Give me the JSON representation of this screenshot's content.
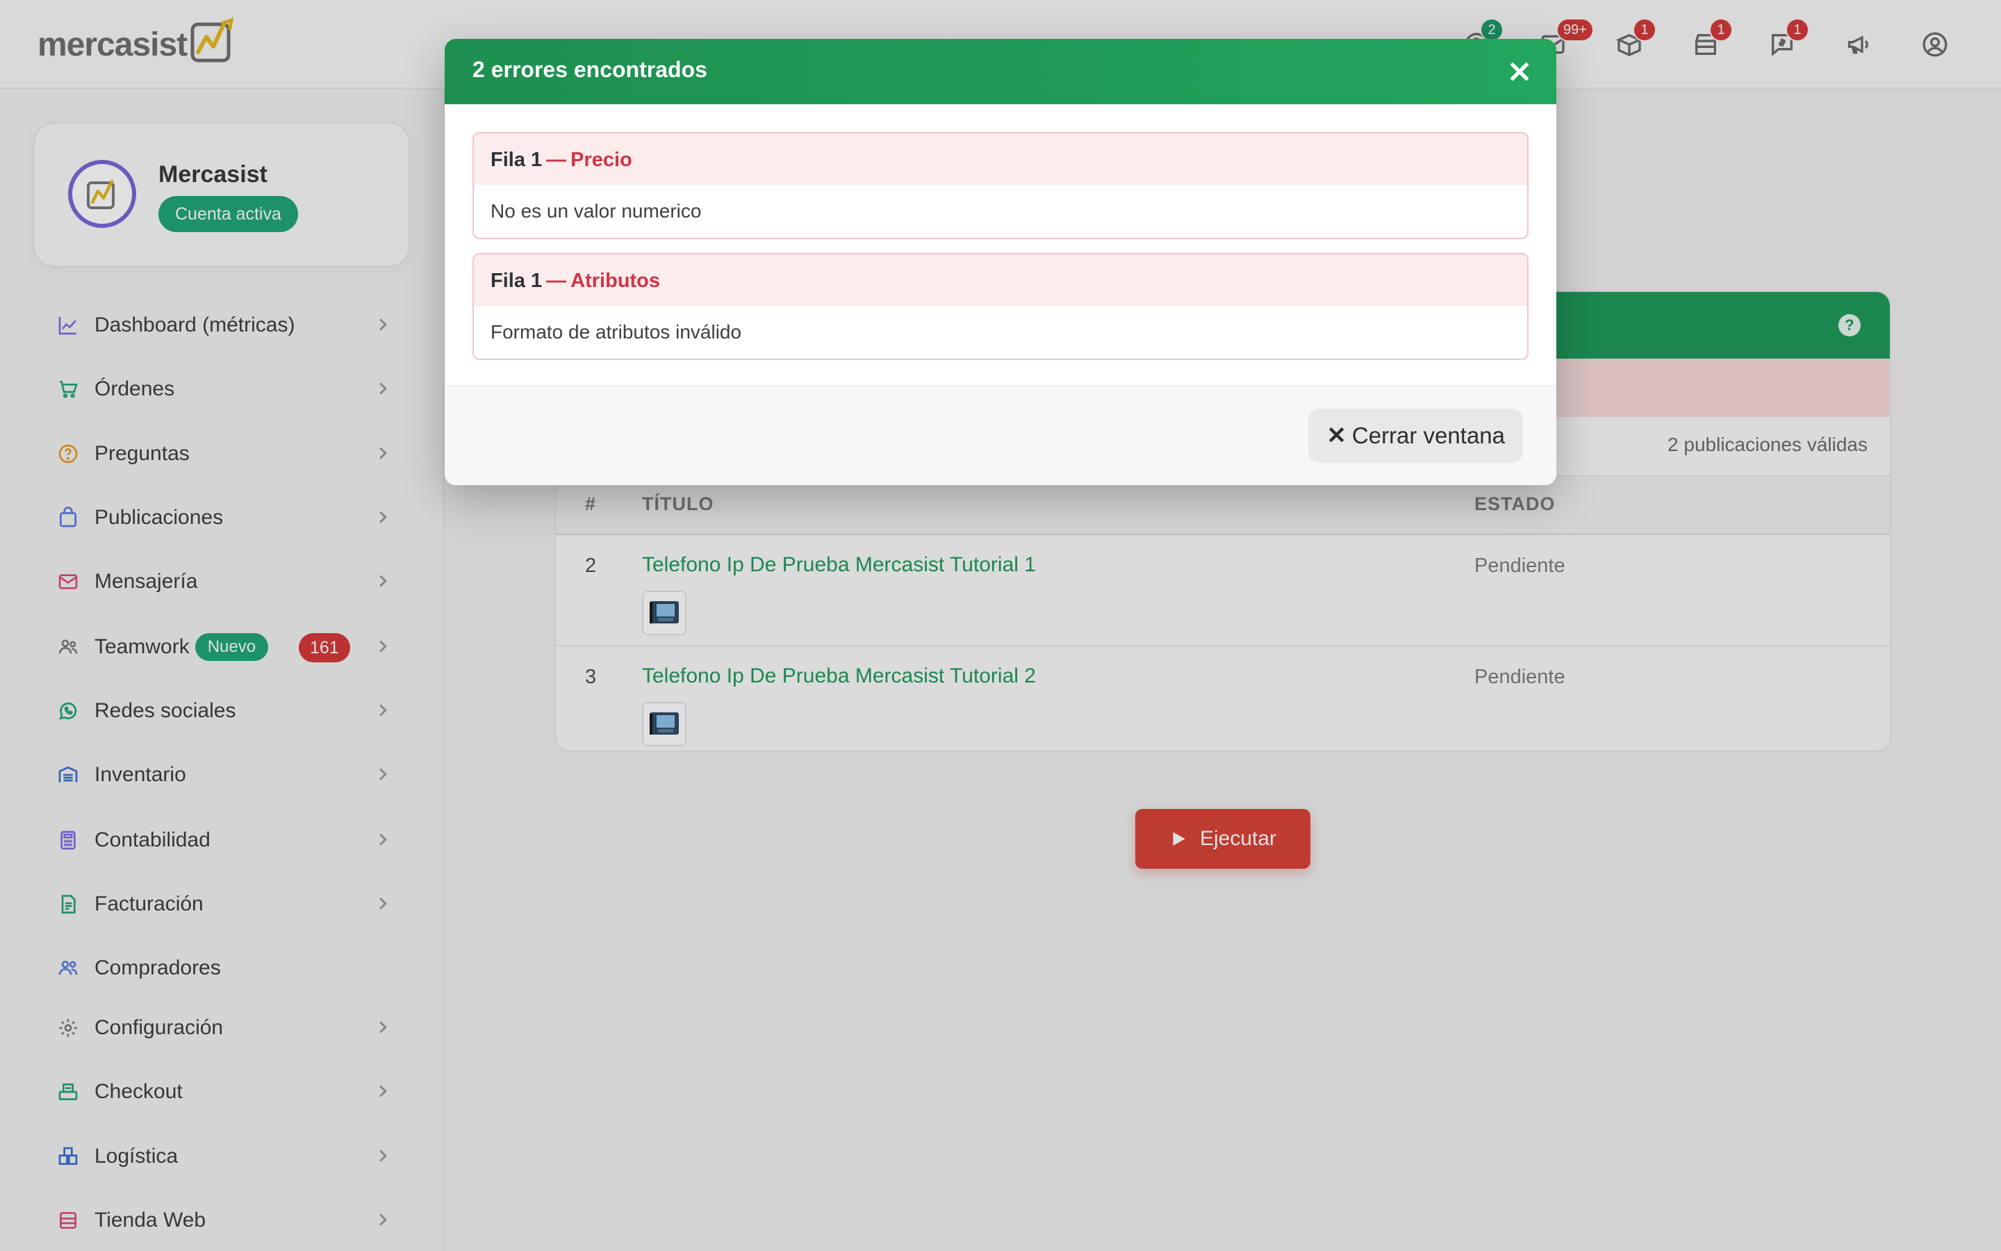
{
  "brand": {
    "logo_text": "mercasist",
    "accent_color": "#1f9a5a",
    "danger_color": "#d43a3a"
  },
  "header": {
    "icons": [
      {
        "name": "help-icon",
        "badge": "2",
        "badge_color": "green"
      },
      {
        "name": "mail-icon",
        "badge": "99+",
        "badge_color": "red"
      },
      {
        "name": "box-icon",
        "badge": "1",
        "badge_color": "red"
      },
      {
        "name": "store-icon",
        "badge": "1",
        "badge_color": "red"
      },
      {
        "name": "chat-money-icon",
        "badge": "1",
        "badge_color": "red"
      },
      {
        "name": "megaphone-icon",
        "badge": "",
        "badge_color": ""
      },
      {
        "name": "user-circle-icon",
        "badge": "",
        "badge_color": ""
      }
    ]
  },
  "sidebar": {
    "profile": {
      "name": "Mercasist",
      "status": "Cuenta activa"
    },
    "items": [
      {
        "label": "Dashboard (métricas)",
        "icon": "chart-line-icon",
        "has_chevron": true
      },
      {
        "label": "Órdenes",
        "icon": "cart-icon",
        "has_chevron": true
      },
      {
        "label": "Preguntas",
        "icon": "question-icon",
        "has_chevron": true
      },
      {
        "label": "Publicaciones",
        "icon": "bag-icon",
        "has_chevron": true
      },
      {
        "label": "Mensajería",
        "icon": "envelope-icon",
        "has_chevron": true
      },
      {
        "label": "Teamwork",
        "icon": "team-icon",
        "has_chevron": true,
        "tag": "Nuevo",
        "count": "161"
      },
      {
        "label": "Redes sociales",
        "icon": "whatsapp-icon",
        "has_chevron": true
      },
      {
        "label": "Inventario",
        "icon": "warehouse-icon",
        "has_chevron": true
      },
      {
        "label": "Contabilidad",
        "icon": "calculator-icon",
        "has_chevron": true
      },
      {
        "label": "Facturación",
        "icon": "invoice-icon",
        "has_chevron": true
      },
      {
        "label": "Compradores",
        "icon": "buyers-icon",
        "has_chevron": false
      },
      {
        "label": "Configuración",
        "icon": "gear-icon",
        "has_chevron": true
      },
      {
        "label": "Checkout",
        "icon": "checkout-icon",
        "has_chevron": true
      },
      {
        "label": "Logística",
        "icon": "truck-icon",
        "has_chevron": true
      },
      {
        "label": "Tienda Web",
        "icon": "shop-icon",
        "has_chevron": true
      }
    ]
  },
  "table": {
    "valid_count_text": "2 publicaciones válidas",
    "columns": [
      "#",
      "TÍTULO",
      "ESTADO"
    ],
    "rows": [
      {
        "num": "2",
        "title": "Telefono Ip De Prueba Mercasist Tutorial 1",
        "state": "Pendiente"
      },
      {
        "num": "3",
        "title": "Telefono Ip De Prueba Mercasist Tutorial 2",
        "state": "Pendiente"
      }
    ],
    "execute_label": "Ejecutar"
  },
  "modal": {
    "title": "2 errores encontrados",
    "errors": [
      {
        "row": "Fila 1",
        "separator": "—",
        "field": "Precio",
        "message": "No es un valor numerico"
      },
      {
        "row": "Fila 1",
        "separator": "—",
        "field": "Atributos",
        "message": "Formato de atributos inválido"
      }
    ],
    "close_label": "Cerrar ventana",
    "close_symbol": "✕"
  }
}
